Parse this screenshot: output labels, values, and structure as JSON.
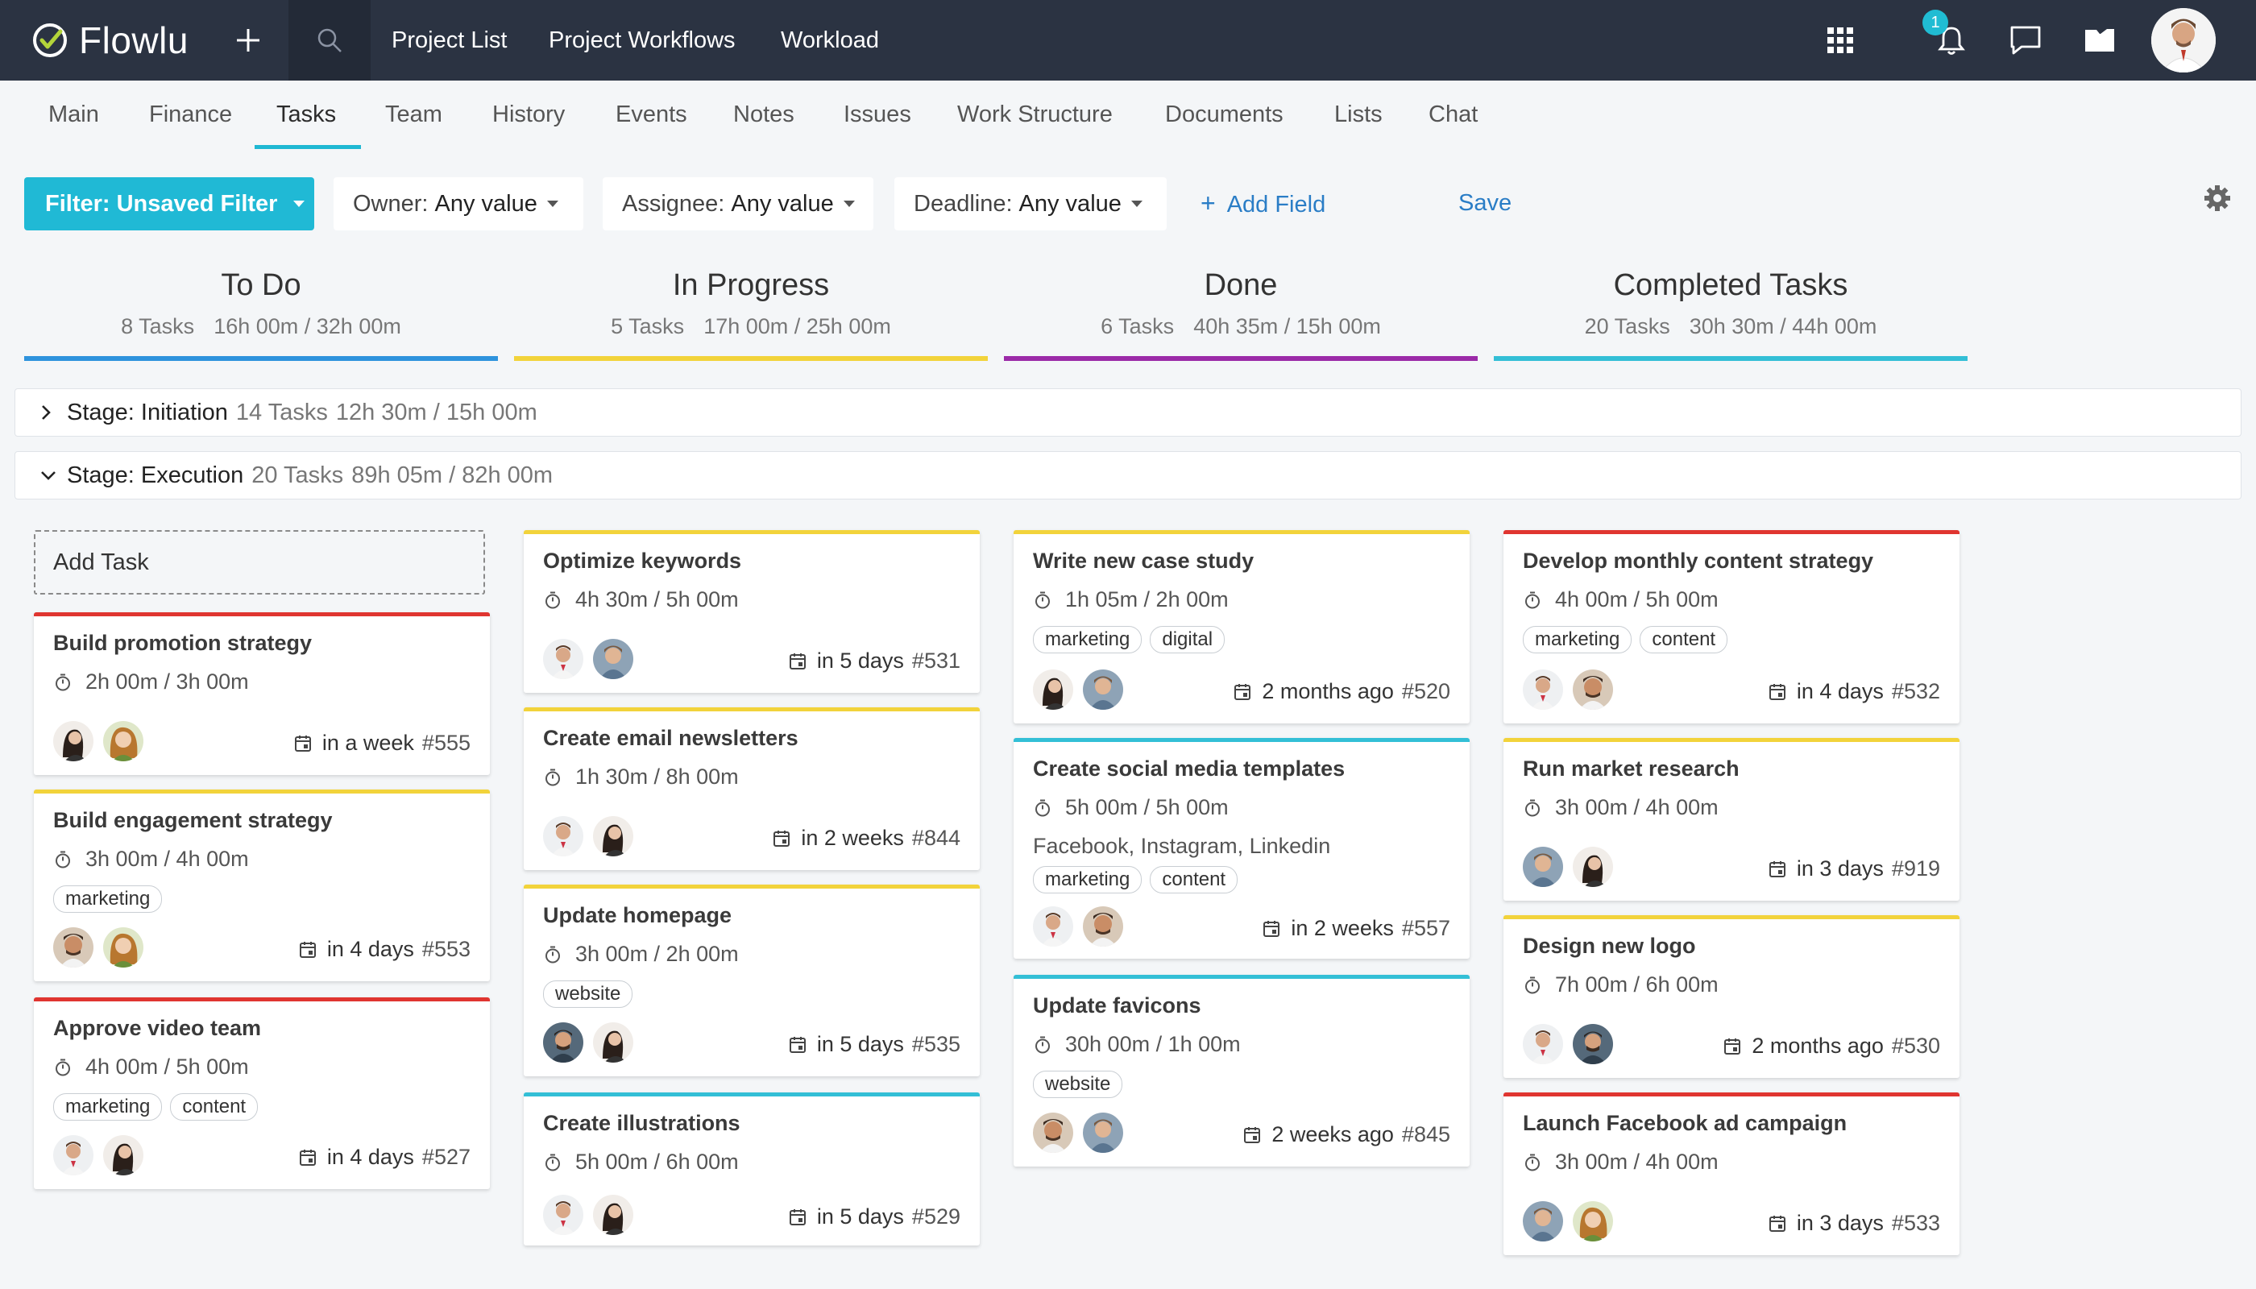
{
  "app": {
    "name": "Flowlu"
  },
  "topnav": [
    {
      "label": "Project List"
    },
    {
      "label": "Project Workflows"
    },
    {
      "label": "Workload"
    }
  ],
  "notifications": {
    "count": "1"
  },
  "tabs": [
    {
      "label": "Main"
    },
    {
      "label": "Finance"
    },
    {
      "label": "Tasks"
    },
    {
      "label": "Team"
    },
    {
      "label": "History"
    },
    {
      "label": "Events"
    },
    {
      "label": "Notes"
    },
    {
      "label": "Issues"
    },
    {
      "label": "Work Structure"
    },
    {
      "label": "Documents"
    },
    {
      "label": "Lists"
    },
    {
      "label": "Chat"
    }
  ],
  "active_tab": "Tasks",
  "filters": {
    "main": "Filter: Unsaved Filter",
    "owner": {
      "label": "Owner:",
      "value": "Any value"
    },
    "assignee": {
      "label": "Assignee:",
      "value": "Any value"
    },
    "deadline": {
      "label": "Deadline:",
      "value": "Any value"
    },
    "add_field": "Add Field",
    "save": "Save"
  },
  "columns": [
    {
      "title": "To Do",
      "count": "8 Tasks",
      "time": "16h 00m / 32h 00m",
      "color": "#2e93dd"
    },
    {
      "title": "In Progress",
      "count": "5 Tasks",
      "time": "17h 00m / 25h 00m",
      "color": "#f2d33b"
    },
    {
      "title": "Done",
      "count": "6 Tasks",
      "time": "40h 35m / 15h 00m",
      "color": "#9b2aa8"
    },
    {
      "title": "Completed Tasks",
      "count": "20 Tasks",
      "time": "30h 30m / 44h 00m",
      "color": "#33bfd6"
    }
  ],
  "stages": [
    {
      "name": "Stage: Initiation",
      "count": "14 Tasks",
      "time": "12h 30m / 15h 00m",
      "expanded": false
    },
    {
      "name": "Stage: Execution",
      "count": "20 Tasks",
      "time": "89h 05m / 82h 00m",
      "expanded": true
    }
  ],
  "add_task": "Add Task",
  "cards": [
    {
      "title": "Build promotion strategy",
      "time": "2h 00m / 3h 00m",
      "due": "in a week",
      "id": "#555",
      "color": "red"
    },
    {
      "title": "Build engagement strategy",
      "time": "3h 00m / 4h 00m",
      "tags": [
        "marketing"
      ],
      "due": "in 4 days",
      "id": "#553",
      "color": "yellow"
    },
    {
      "title": "Approve video team",
      "time": "4h 00m / 5h 00m",
      "tags": [
        "marketing",
        "content"
      ],
      "due": "in 4 days",
      "id": "#527",
      "color": "red"
    },
    {
      "title": "Optimize keywords",
      "time": "4h 30m / 5h 00m",
      "due": "in 5 days",
      "id": "#531",
      "color": "yellow"
    },
    {
      "title": "Create email newsletters",
      "time": "1h 30m / 8h 00m",
      "due": "in 2 weeks",
      "id": "#844",
      "color": "yellow"
    },
    {
      "title": "Update homepage",
      "time": "3h 00m / 2h 00m",
      "tags": [
        "website"
      ],
      "due": "in 5 days",
      "id": "#535",
      "color": "yellow"
    },
    {
      "title": "Create illustrations",
      "time": "5h 00m / 6h 00m",
      "due": "in 5 days",
      "id": "#529",
      "color": "cyan"
    },
    {
      "title": "Write new case study",
      "time": "1h 05m / 2h 00m",
      "tags": [
        "marketing",
        "digital"
      ],
      "due": "2 months ago",
      "id": "#520",
      "color": "yellow"
    },
    {
      "title": "Create social media templates",
      "time": "5h 00m / 5h 00m",
      "note": "Facebook, Instagram, Linkedin",
      "tags": [
        "marketing",
        "content"
      ],
      "due": "in 2 weeks",
      "id": "#557",
      "color": "cyan"
    },
    {
      "title": "Update favicons",
      "time": "30h 00m / 1h 00m",
      "tags": [
        "website"
      ],
      "due": "2 weeks ago",
      "id": "#845",
      "color": "cyan"
    },
    {
      "title": "Develop monthly content strategy",
      "time": "4h 00m / 5h 00m",
      "tags": [
        "marketing",
        "content"
      ],
      "due": "in 4 days",
      "id": "#532",
      "color": "red"
    },
    {
      "title": "Run market research",
      "time": "3h 00m / 4h 00m",
      "due": "in 3 days",
      "id": "#919",
      "color": "yellow"
    },
    {
      "title": "Design new logo",
      "time": "7h 00m / 6h 00m",
      "due": "2 months ago",
      "id": "#530",
      "color": "yellow"
    },
    {
      "title": "Launch Facebook ad campaign",
      "time": "3h 00m / 4h 00m",
      "due": "in 3 days",
      "id": "#533",
      "color": "red"
    }
  ]
}
